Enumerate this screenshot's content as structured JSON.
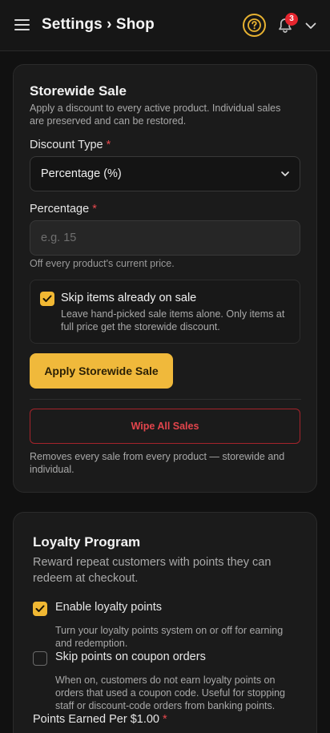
{
  "header": {
    "title": "Settings › Shop",
    "notification_count": "3",
    "accent_color": "#e7b231",
    "badge_color": "#e5252e"
  },
  "storewide_sale": {
    "title": "Storewide Sale",
    "description": "Apply a discount to every active product. Individual sales are preserved and can be restored.",
    "discount_type_label": "Discount Type",
    "required_mark": "*",
    "discount_type_value": "Percentage (%)",
    "percentage_label": "Percentage",
    "percentage_placeholder": "e.g. 15",
    "percentage_value": "",
    "percentage_hint": "Off every product's current price.",
    "skip_sale_title": "Skip items already on sale",
    "skip_sale_desc": "Leave hand-picked sale items alone. Only items at full price get the storewide discount.",
    "skip_sale_checked": true,
    "apply_button": "Apply Storewide Sale",
    "wipe_button": "Wipe All Sales",
    "wipe_desc": "Removes every sale from every product — storewide and individual."
  },
  "loyalty": {
    "title": "Loyalty Program",
    "description": "Reward repeat customers with points they can redeem at checkout.",
    "enable_label": "Enable loyalty points",
    "enable_checked": true,
    "enable_desc": "Turn your loyalty points system on or off for earning and redemption.",
    "skip_coupon_label": "Skip points on coupon orders",
    "skip_coupon_checked": false,
    "skip_coupon_desc": "When on, customers do not earn loyalty points on orders that used a coupon code. Useful for stopping staff or discount-code orders from banking points.",
    "points_label": "Points Earned Per $1.00",
    "required_mark": "*"
  },
  "icons": [
    "menu-icon",
    "help-icon",
    "bell-icon",
    "chevron-down-icon",
    "checkmark-icon"
  ]
}
